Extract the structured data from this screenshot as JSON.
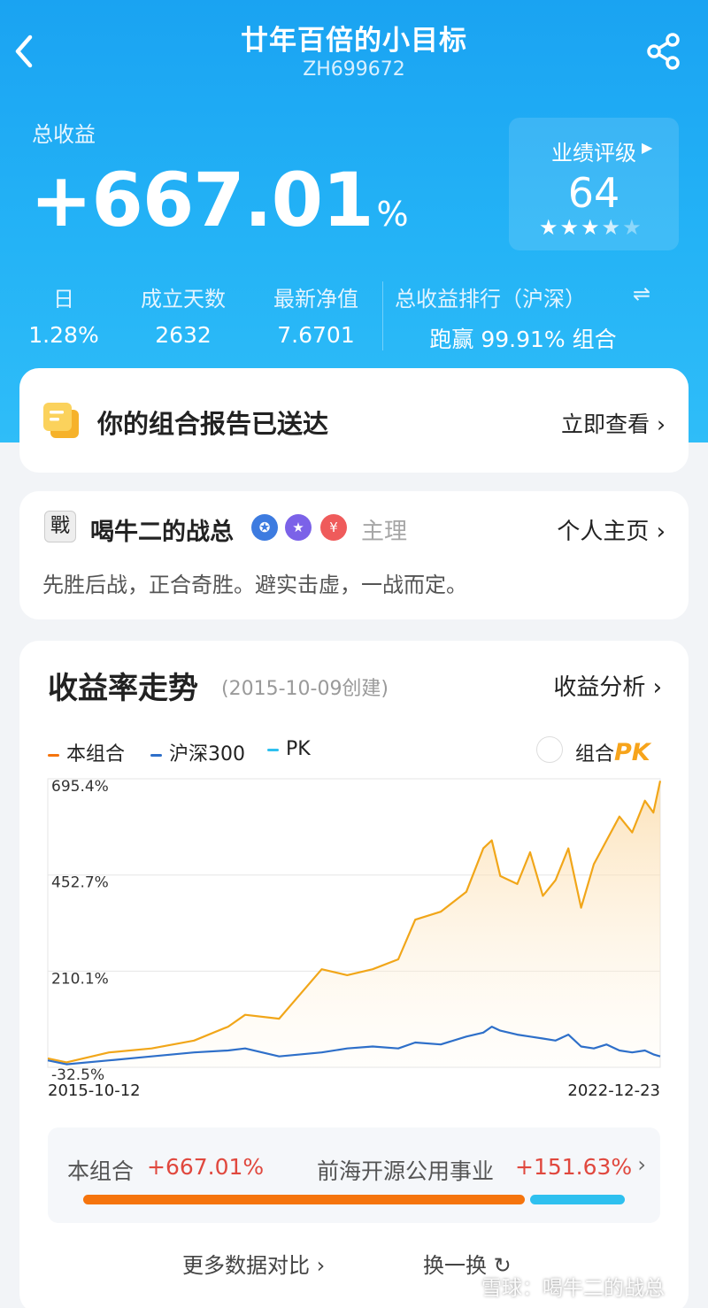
{
  "header": {
    "title": "廿年百倍的小目标",
    "code": "ZH699672"
  },
  "summary": {
    "total_label": "总收益",
    "total_value": "+667.01",
    "total_unit": "%",
    "rating_label": "业绩评级",
    "rating_score": "64",
    "rating_stars": 3.5
  },
  "stats": [
    {
      "label": "日",
      "value": "1.28%"
    },
    {
      "label": "成立天数",
      "value": "2632"
    },
    {
      "label": "最新净值",
      "value": "7.6701"
    }
  ],
  "ranking": {
    "label": "总收益排行（沪深）",
    "value": "跑赢 99.91% 组合"
  },
  "report": {
    "text": "你的组合报告已送达",
    "link": "立即查看"
  },
  "manager": {
    "avatar_char": "戰",
    "name": "喝牛二的战总",
    "role": "主理",
    "homepage": "个人主页",
    "motto": "先胜后战，正合奇胜。避实击虚，一战而定。"
  },
  "chart_section": {
    "title": "收益率走势",
    "created": "(2015-10-09创建)",
    "analysis_link": "收益分析",
    "pk_label": "组合",
    "pk_word": "PK",
    "colors": {
      "portfolio": "#f1a619",
      "hs300": "#2e6fc9",
      "pk": "#2ec0ef"
    }
  },
  "chart_data": {
    "type": "line",
    "x_start": "2015-10-12",
    "x_end": "2022-12-23",
    "y_ticks": [
      "695.4%",
      "452.7%",
      "210.1%",
      "-32.5%"
    ],
    "ylim": [
      -32.5,
      695.4
    ],
    "x": [
      2015.78,
      2016.0,
      2016.5,
      2017.0,
      2017.5,
      2017.9,
      2018.1,
      2018.5,
      2019.0,
      2019.3,
      2019.6,
      2019.9,
      2020.1,
      2020.4,
      2020.7,
      2020.9,
      2021.0,
      2021.1,
      2021.3,
      2021.45,
      2021.6,
      2021.75,
      2021.9,
      2022.05,
      2022.2,
      2022.35,
      2022.5,
      2022.65,
      2022.8,
      2022.9,
      2022.98
    ],
    "series": [
      {
        "name": "本组合",
        "values": [
          -10,
          -20,
          5,
          15,
          35,
          70,
          100,
          90,
          215,
          200,
          215,
          240,
          340,
          360,
          410,
          520,
          540,
          450,
          430,
          510,
          400,
          440,
          520,
          370,
          480,
          540,
          600,
          560,
          640,
          610,
          690
        ]
      },
      {
        "name": "沪深300",
        "values": [
          -15,
          -25,
          -15,
          -5,
          5,
          10,
          15,
          -5,
          5,
          15,
          20,
          15,
          30,
          25,
          45,
          55,
          70,
          60,
          50,
          45,
          40,
          35,
          50,
          20,
          15,
          25,
          10,
          5,
          10,
          0,
          -5
        ]
      }
    ],
    "legend": [
      "本组合",
      "沪深300",
      "PK"
    ]
  },
  "compare": {
    "left_label": "本组合",
    "left_value": "+667.01%",
    "right_label": "前海开源公用事业",
    "right_value": "+151.63%",
    "left_share": 0.815,
    "right_share": 0.185
  },
  "footer": {
    "more": "更多数据对比",
    "swap": "换一换",
    "watermark": "雪球：喝牛二的战总"
  }
}
